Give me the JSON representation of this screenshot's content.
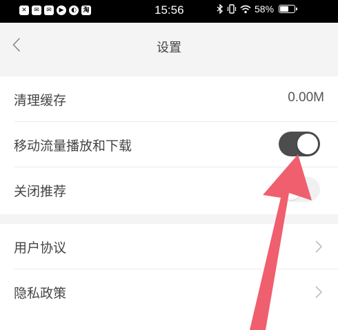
{
  "status_bar": {
    "time": "15:56",
    "battery_text": "58%",
    "battery_level": 0.58,
    "notification_icons": [
      "close-app-icon",
      "mail-icon",
      "mail-icon",
      "play-icon",
      "compass-icon",
      "taobao-icon"
    ],
    "tao_glyph": "淘"
  },
  "nav": {
    "title": "设置"
  },
  "settings": {
    "clear_cache_label": "清理缓存",
    "clear_cache_value": "0.00M",
    "mobile_data_label": "移动流量播放和下载",
    "mobile_data_on": true,
    "close_recommend_label": "关闭推荐",
    "close_recommend_on": false,
    "user_agreement_label": "用户协议",
    "privacy_policy_label": "隐私政策"
  },
  "annotation": {
    "arrow_color": "#ef5f6e"
  }
}
